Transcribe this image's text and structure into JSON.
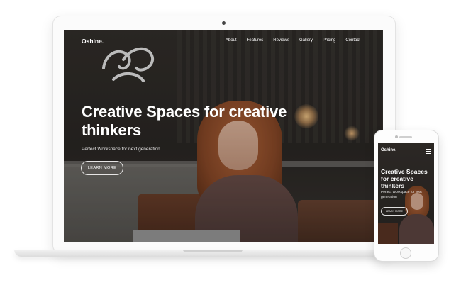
{
  "site": {
    "logo": "Oshine.",
    "nav": [
      "About",
      "Features",
      "Reviews",
      "Gallery",
      "Pricing",
      "Contact"
    ]
  },
  "hero": {
    "title": "Creative Spaces for creative thinkers",
    "subtitle": "Perfect Workspace for next generation",
    "button": "LEARN MORE"
  },
  "mobile": {
    "logo": "Oshine.",
    "title": "Creative Spaces for creative thinkers",
    "subtitle": "Perfect Workspace for next generation",
    "button": "LEARN MORE",
    "menu_icon": "hamburger-icon"
  },
  "colors": {
    "text": "#ffffff",
    "overlay": "#000000",
    "device": "#fbfbfb"
  }
}
